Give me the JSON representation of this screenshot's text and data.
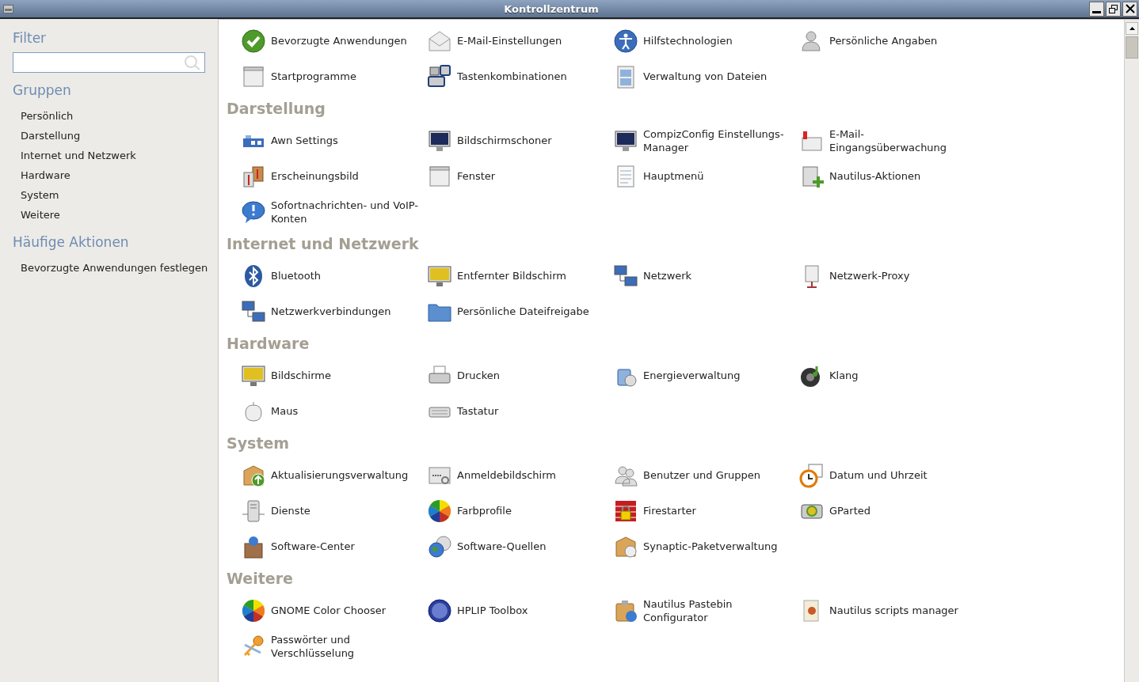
{
  "window": {
    "title": "Kontrollzentrum"
  },
  "sidebar": {
    "filter_heading": "Filter",
    "groups_heading": "Gruppen",
    "groups": [
      {
        "label": "Persönlich"
      },
      {
        "label": "Darstellung"
      },
      {
        "label": "Internet und Netzwerk"
      },
      {
        "label": "Hardware"
      },
      {
        "label": "System"
      },
      {
        "label": "Weitere"
      }
    ],
    "actions_heading": "Häufige Aktionen",
    "actions": [
      {
        "label": "Bevorzugte Anwendungen festlegen"
      }
    ]
  },
  "sections": [
    {
      "items": [
        {
          "label": "Bevorzugte Anwendungen"
        },
        {
          "label": "E-Mail-Einstellungen"
        },
        {
          "label": "Hilfstechnologien"
        },
        {
          "label": "Persönliche Angaben"
        },
        {
          "label": "Startprogramme"
        },
        {
          "label": "Tastenkombinationen"
        },
        {
          "label": "Verwaltung von Dateien"
        }
      ]
    },
    {
      "heading": "Darstellung",
      "items": [
        {
          "label": "Awn Settings"
        },
        {
          "label": "Bildschirmschoner"
        },
        {
          "label": "CompizConfig Einstellungs-Manager"
        },
        {
          "label": "E-Mail-Eingangsüberwachung"
        },
        {
          "label": "Erscheinungsbild"
        },
        {
          "label": "Fenster"
        },
        {
          "label": "Hauptmenü"
        },
        {
          "label": "Nautilus-Aktionen"
        },
        {
          "label": "Sofortnachrichten- und VoIP-Konten"
        }
      ]
    },
    {
      "heading": "Internet und Netzwerk",
      "items": [
        {
          "label": "Bluetooth"
        },
        {
          "label": "Entfernter Bildschirm"
        },
        {
          "label": "Netzwerk"
        },
        {
          "label": "Netzwerk-Proxy"
        },
        {
          "label": "Netzwerkverbindungen"
        },
        {
          "label": "Persönliche Dateifreigabe"
        }
      ]
    },
    {
      "heading": "Hardware",
      "items": [
        {
          "label": "Bildschirme"
        },
        {
          "label": "Drucken"
        },
        {
          "label": "Energieverwaltung"
        },
        {
          "label": "Klang"
        },
        {
          "label": "Maus"
        },
        {
          "label": "Tastatur"
        }
      ]
    },
    {
      "heading": "System",
      "items": [
        {
          "label": "Aktualisierungsverwaltung"
        },
        {
          "label": "Anmeldebildschirm"
        },
        {
          "label": "Benutzer und Gruppen"
        },
        {
          "label": "Datum und Uhrzeit"
        },
        {
          "label": "Dienste"
        },
        {
          "label": "Farbprofile"
        },
        {
          "label": "Firestarter"
        },
        {
          "label": "GParted"
        },
        {
          "label": "Software-Center"
        },
        {
          "label": "Software-Quellen"
        },
        {
          "label": "Synaptic-Paketverwaltung"
        }
      ]
    },
    {
      "heading": "Weitere",
      "items": [
        {
          "label": "GNOME Color Chooser"
        },
        {
          "label": "HPLIP Toolbox"
        },
        {
          "label": "Nautilus Pastebin Configurator"
        },
        {
          "label": "Nautilus scripts manager"
        },
        {
          "label": "Passwörter und Verschlüsselung"
        }
      ]
    }
  ]
}
